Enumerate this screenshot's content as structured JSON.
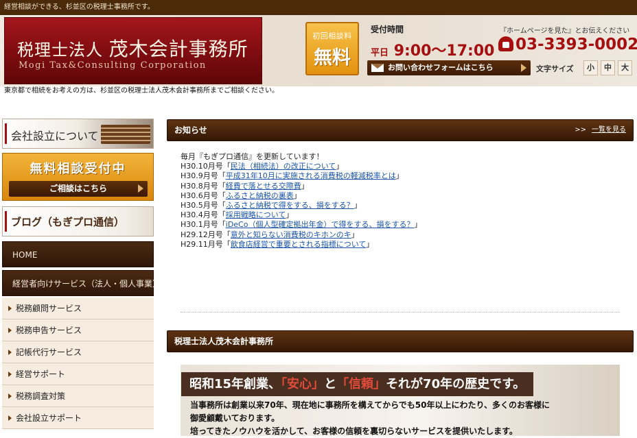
{
  "topbar": {
    "text": "経営相談ができる、杉並区の税理士事務所です。"
  },
  "header": {
    "logo_title_prefix": "税理士法人",
    "logo_title_main": "茂木会計事務所",
    "logo_subtitle": "Mogi Tax&Consulting Corporation",
    "free_badge_line1": "初回相談料",
    "free_badge_line2": "無料",
    "hours_title": "受付時間",
    "hours_days": "平日",
    "hours_value": "9:00〜17:00",
    "note": "『ホームページを見た』とお伝えください",
    "phone": "03-3393-0002",
    "contact_button": "お問い合わせフォームはこちら",
    "font_size_label": "文字サイズ",
    "font_sizes": [
      "小",
      "中",
      "大"
    ]
  },
  "intro": "東京都で相続をお考えの方は、杉並区の税理士法人茂木会計事務所までご相談ください。",
  "sidebar": {
    "company_banner": "会社設立について",
    "free_banner_title": "無料相談受付中",
    "free_banner_button": "ご相談はこちら",
    "blog_banner": "ブログ（もぎプロ通信）",
    "home": "HOME",
    "category": "経営者向けサービス（法人・個人事業）",
    "items": [
      {
        "label": "税務顧問サービス"
      },
      {
        "label": "税務申告サービス"
      },
      {
        "label": "記帳代行サービス"
      },
      {
        "label": "経営サポート"
      },
      {
        "label": "税務調査対策"
      },
      {
        "label": "会社設立サポート"
      }
    ]
  },
  "news": {
    "heading": "お知らせ",
    "more": "一覧を見る",
    "intro_line": "毎月『もぎプロ通信』を更新しています！",
    "items": [
      {
        "prefix": "H30.10月号「",
        "link": "民法（相続法）の改正について",
        "suffix": "」"
      },
      {
        "prefix": "H30.9月号「",
        "link": "平成31年10月に実施される消費税の軽減税率とは",
        "suffix": "」"
      },
      {
        "prefix": "H30.8月号「",
        "link": "経費で落とせる交際費",
        "suffix": "」"
      },
      {
        "prefix": "H30.6月号「",
        "link": "ふるさと納税の裏表",
        "suffix": "」"
      },
      {
        "prefix": "H30.5月号「",
        "link": "ふるさと納税で得をする、損をする？",
        "suffix": "」"
      },
      {
        "prefix": "H30.4月号「",
        "link": "採用戦略について",
        "suffix": "」"
      },
      {
        "prefix": "H30.1月号「",
        "link": "iDeCo（個人型確定拠出年金）で得をする、損をする？",
        "suffix": "」"
      },
      {
        "prefix": "H29.12月号「",
        "link": "意外と知らない消費税のキホンのキ",
        "suffix": "」"
      },
      {
        "prefix": "H29.11月号「",
        "link": "飲食店経営で重要とされる指標について",
        "suffix": "」"
      }
    ]
  },
  "about": {
    "heading": "税理士法人茂木会計事務所",
    "hero_pre": "昭和15年創業、",
    "hero_kw1": "「安心」",
    "hero_mid": "と",
    "hero_kw2": "「信頼」",
    "hero_post": "それが70年の歴史です。",
    "body_line1": "当事務所は創業以来70年、現在地に事務所を構えてからでも50年以上にわたり、多くのお客様に",
    "body_line2": "御愛顧戴いております。",
    "body_line3": "培ってきたノウハウを活かして、お客様の信頼を裏切らないサービスを提供いたします。"
  }
}
